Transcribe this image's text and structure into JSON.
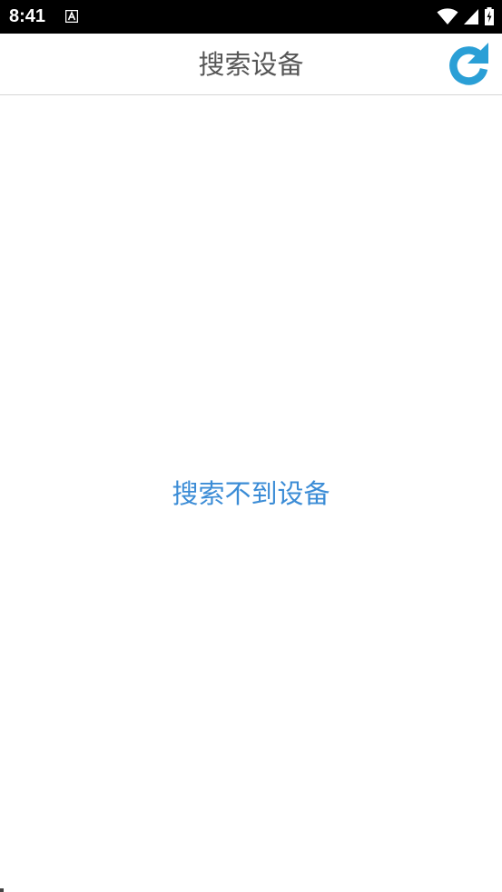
{
  "status_bar": {
    "time": "8:41",
    "icons": [
      "app-notification-icon",
      "wifi-icon",
      "cellular-signal-icon",
      "battery-charging-icon"
    ]
  },
  "app_bar": {
    "title": "搜索设备",
    "refresh_icon": "refresh-icon"
  },
  "main": {
    "empty_message": "搜索不到设备"
  },
  "colors": {
    "status_bar_bg": "#000000",
    "title_text": "#565656",
    "accent_blue": "#2a9fd6",
    "empty_message_text": "#3b8cd6",
    "divider": "#d6d6d6"
  }
}
